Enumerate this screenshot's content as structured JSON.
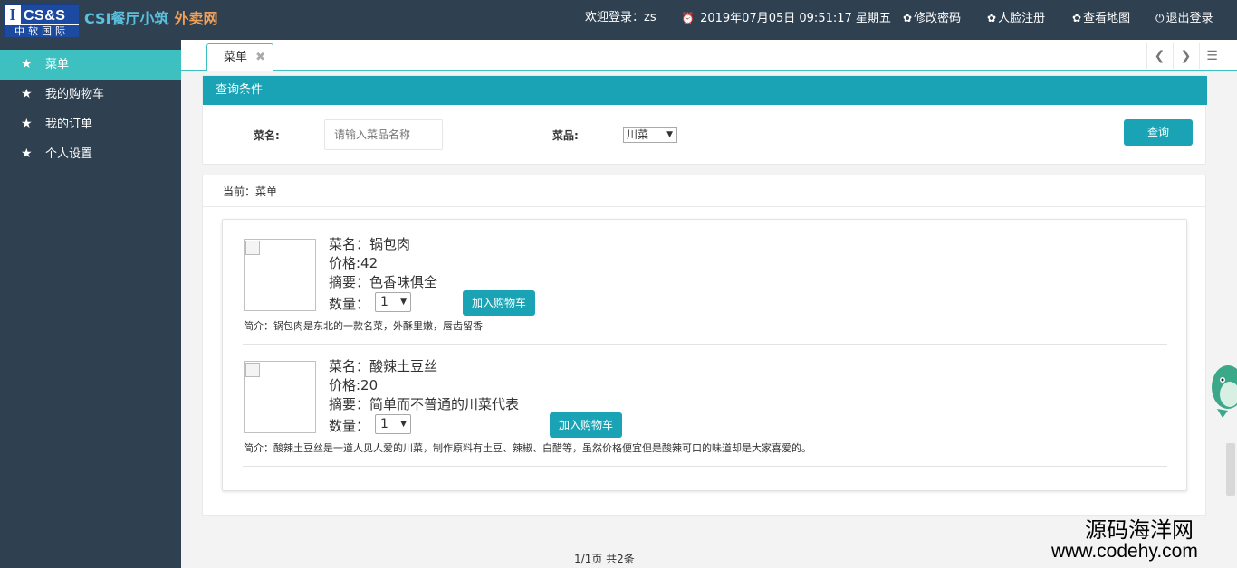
{
  "header": {
    "logo": {
      "top": "CS&S",
      "bottom": "中软国际"
    },
    "brand_main": "CSI餐厅小筑",
    "brand_sub": "外卖网",
    "welcome": "欢迎登录：zs",
    "datetime": "2019年07月05日 09:51:17 星期五",
    "links": {
      "change_password": "修改密码",
      "face_register": "人脸注册",
      "view_map": "查看地图",
      "logout": "退出登录"
    }
  },
  "sidebar": {
    "items": [
      {
        "label": "菜单",
        "active": true
      },
      {
        "label": "我的购物车",
        "active": false
      },
      {
        "label": "我的订单",
        "active": false
      },
      {
        "label": "个人设置",
        "active": false
      }
    ]
  },
  "tabs": [
    {
      "label": "菜单",
      "close": "✖"
    }
  ],
  "query": {
    "title": "查询条件",
    "name_label": "菜名:",
    "name_placeholder": "请输入菜品名称",
    "category_label": "菜品:",
    "category_value": "川菜",
    "submit": "查询"
  },
  "crumb": "当前：菜单",
  "dishes": [
    {
      "name": "菜名：锅包肉",
      "price": "价格:42",
      "summary": "摘要：色香味俱全",
      "qty_label": "数量：",
      "qty": "1",
      "add": "加入购物车",
      "desc": "简介：锅包肉是东北的一款名菜，外酥里嫩，唇齿留香"
    },
    {
      "name": "菜名：酸辣土豆丝",
      "price": "价格:20",
      "summary": "摘要：简单而不普通的川菜代表",
      "qty_label": "数量：",
      "qty": "1",
      "add": "加入购物车",
      "desc": "简介：酸辣土豆丝是一道人见人爱的川菜，制作原料有土豆、辣椒、白醋等，虽然价格便宜但是酸辣可口的味道却是大家喜爱的。"
    }
  ],
  "pager": "1/1页 共2条",
  "watermark": {
    "line1": "源码海洋网",
    "line2": "www.codehy.com"
  },
  "colors": {
    "header": "#2f4050",
    "accent": "#3ec0c0",
    "primary": "#1aa3b4",
    "brand_sub": "#f0a05a"
  }
}
